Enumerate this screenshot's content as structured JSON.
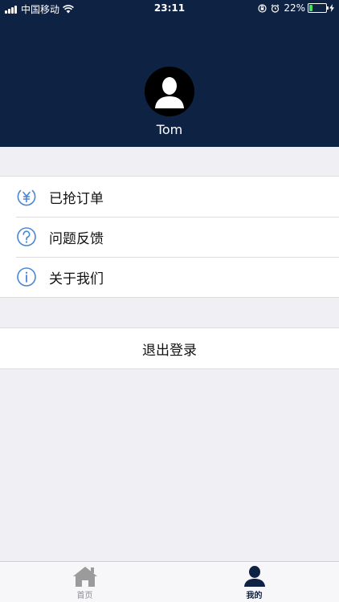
{
  "status_bar": {
    "carrier": "中国移动",
    "time": "23:11",
    "battery_percent": "22%",
    "battery_level": 0.22
  },
  "profile": {
    "username": "Tom"
  },
  "menu": {
    "items": [
      {
        "label": "已抢订单",
        "icon": "yen-icon"
      },
      {
        "label": "问题反馈",
        "icon": "question-icon"
      },
      {
        "label": "关于我们",
        "icon": "info-icon"
      }
    ]
  },
  "logout": {
    "label": "退出登录"
  },
  "tabbar": {
    "tabs": [
      {
        "label": "首页",
        "icon": "home-icon",
        "active": false
      },
      {
        "label": "我的",
        "icon": "user-icon",
        "active": true
      }
    ]
  },
  "colors": {
    "header_bg": "#0e2244",
    "icon_blue": "#4a86d6",
    "page_bg": "#efeff4"
  }
}
